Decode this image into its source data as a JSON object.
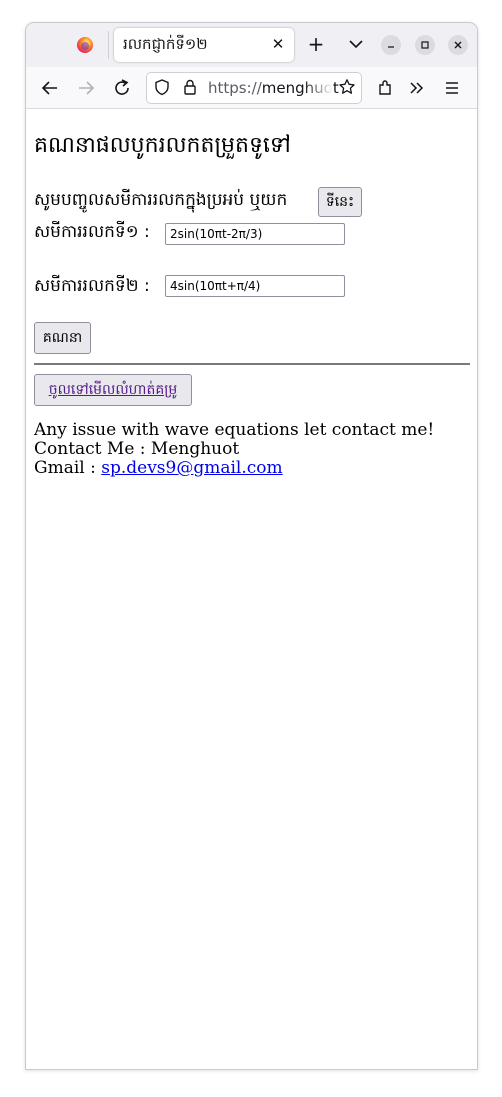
{
  "browser": {
    "tab_title": "រលកជ្ញាក់ទី១២",
    "url_prefix": "https://",
    "url_domain": "menghuot"
  },
  "page": {
    "heading": "គណនាផលបូករលកតម្រួតទូទៅ",
    "instruction": "សូមបញ្ចូលសមីការរលកក្នុងប្រអប់ ឬយក",
    "here_button": "ទីនេះ",
    "eq1_label": "សមីការរលកទី១ :",
    "eq1_value": "2sin(10πt-2π/3)",
    "eq2_label": "សមីការរលកទី២ :",
    "eq2_value": "4sin(10πt+π/4)",
    "calc_button": "គណនា",
    "simplify_button": "ចូលទៅមើលលំហាត់គម្រូ",
    "contact_line1": "Any issue with wave equations let contact me!",
    "contact_line2": "Contact Me : Menghuot",
    "gmail_label": "Gmail :",
    "gmail_value": "sp.devs9@gmail.com"
  }
}
